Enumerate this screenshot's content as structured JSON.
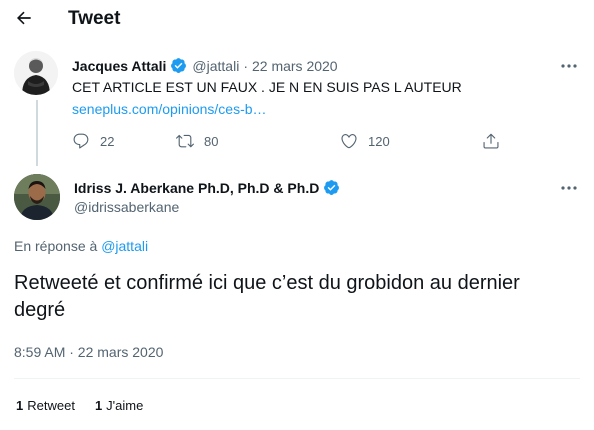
{
  "header": {
    "title": "Tweet",
    "back_icon": "arrow-left-icon"
  },
  "colors": {
    "accent": "#1d9bf0",
    "text": "#0f1419",
    "muted": "#536471"
  },
  "parent_tweet": {
    "author_name": "Jacques Attali",
    "verified": true,
    "handle": "@jattali",
    "separator": "·",
    "date": "22 mars 2020",
    "text": "CET ARTICLE EST UN FAUX . JE N EN SUIS PAS L AUTEUR",
    "link": "seneplus.com/opinions/ces-b…",
    "actions": {
      "reply_count": "22",
      "retweet_count": "80",
      "like_count": "120"
    }
  },
  "main_tweet": {
    "author_name": "Idriss J. Aberkane Ph.D, Ph.D & Ph.D",
    "verified": true,
    "handle": "@idrissaberkane",
    "reply_prefix": "En réponse à",
    "reply_to": "@jattali",
    "text": "Retweeté et confirmé ici que c’est du grobidon au dernier degré",
    "timestamp": "8:59 AM · 22 mars 2020",
    "stats": {
      "retweets_count": "1",
      "retweets_label": "Retweet",
      "likes_count": "1",
      "likes_label": "J'aime"
    }
  }
}
